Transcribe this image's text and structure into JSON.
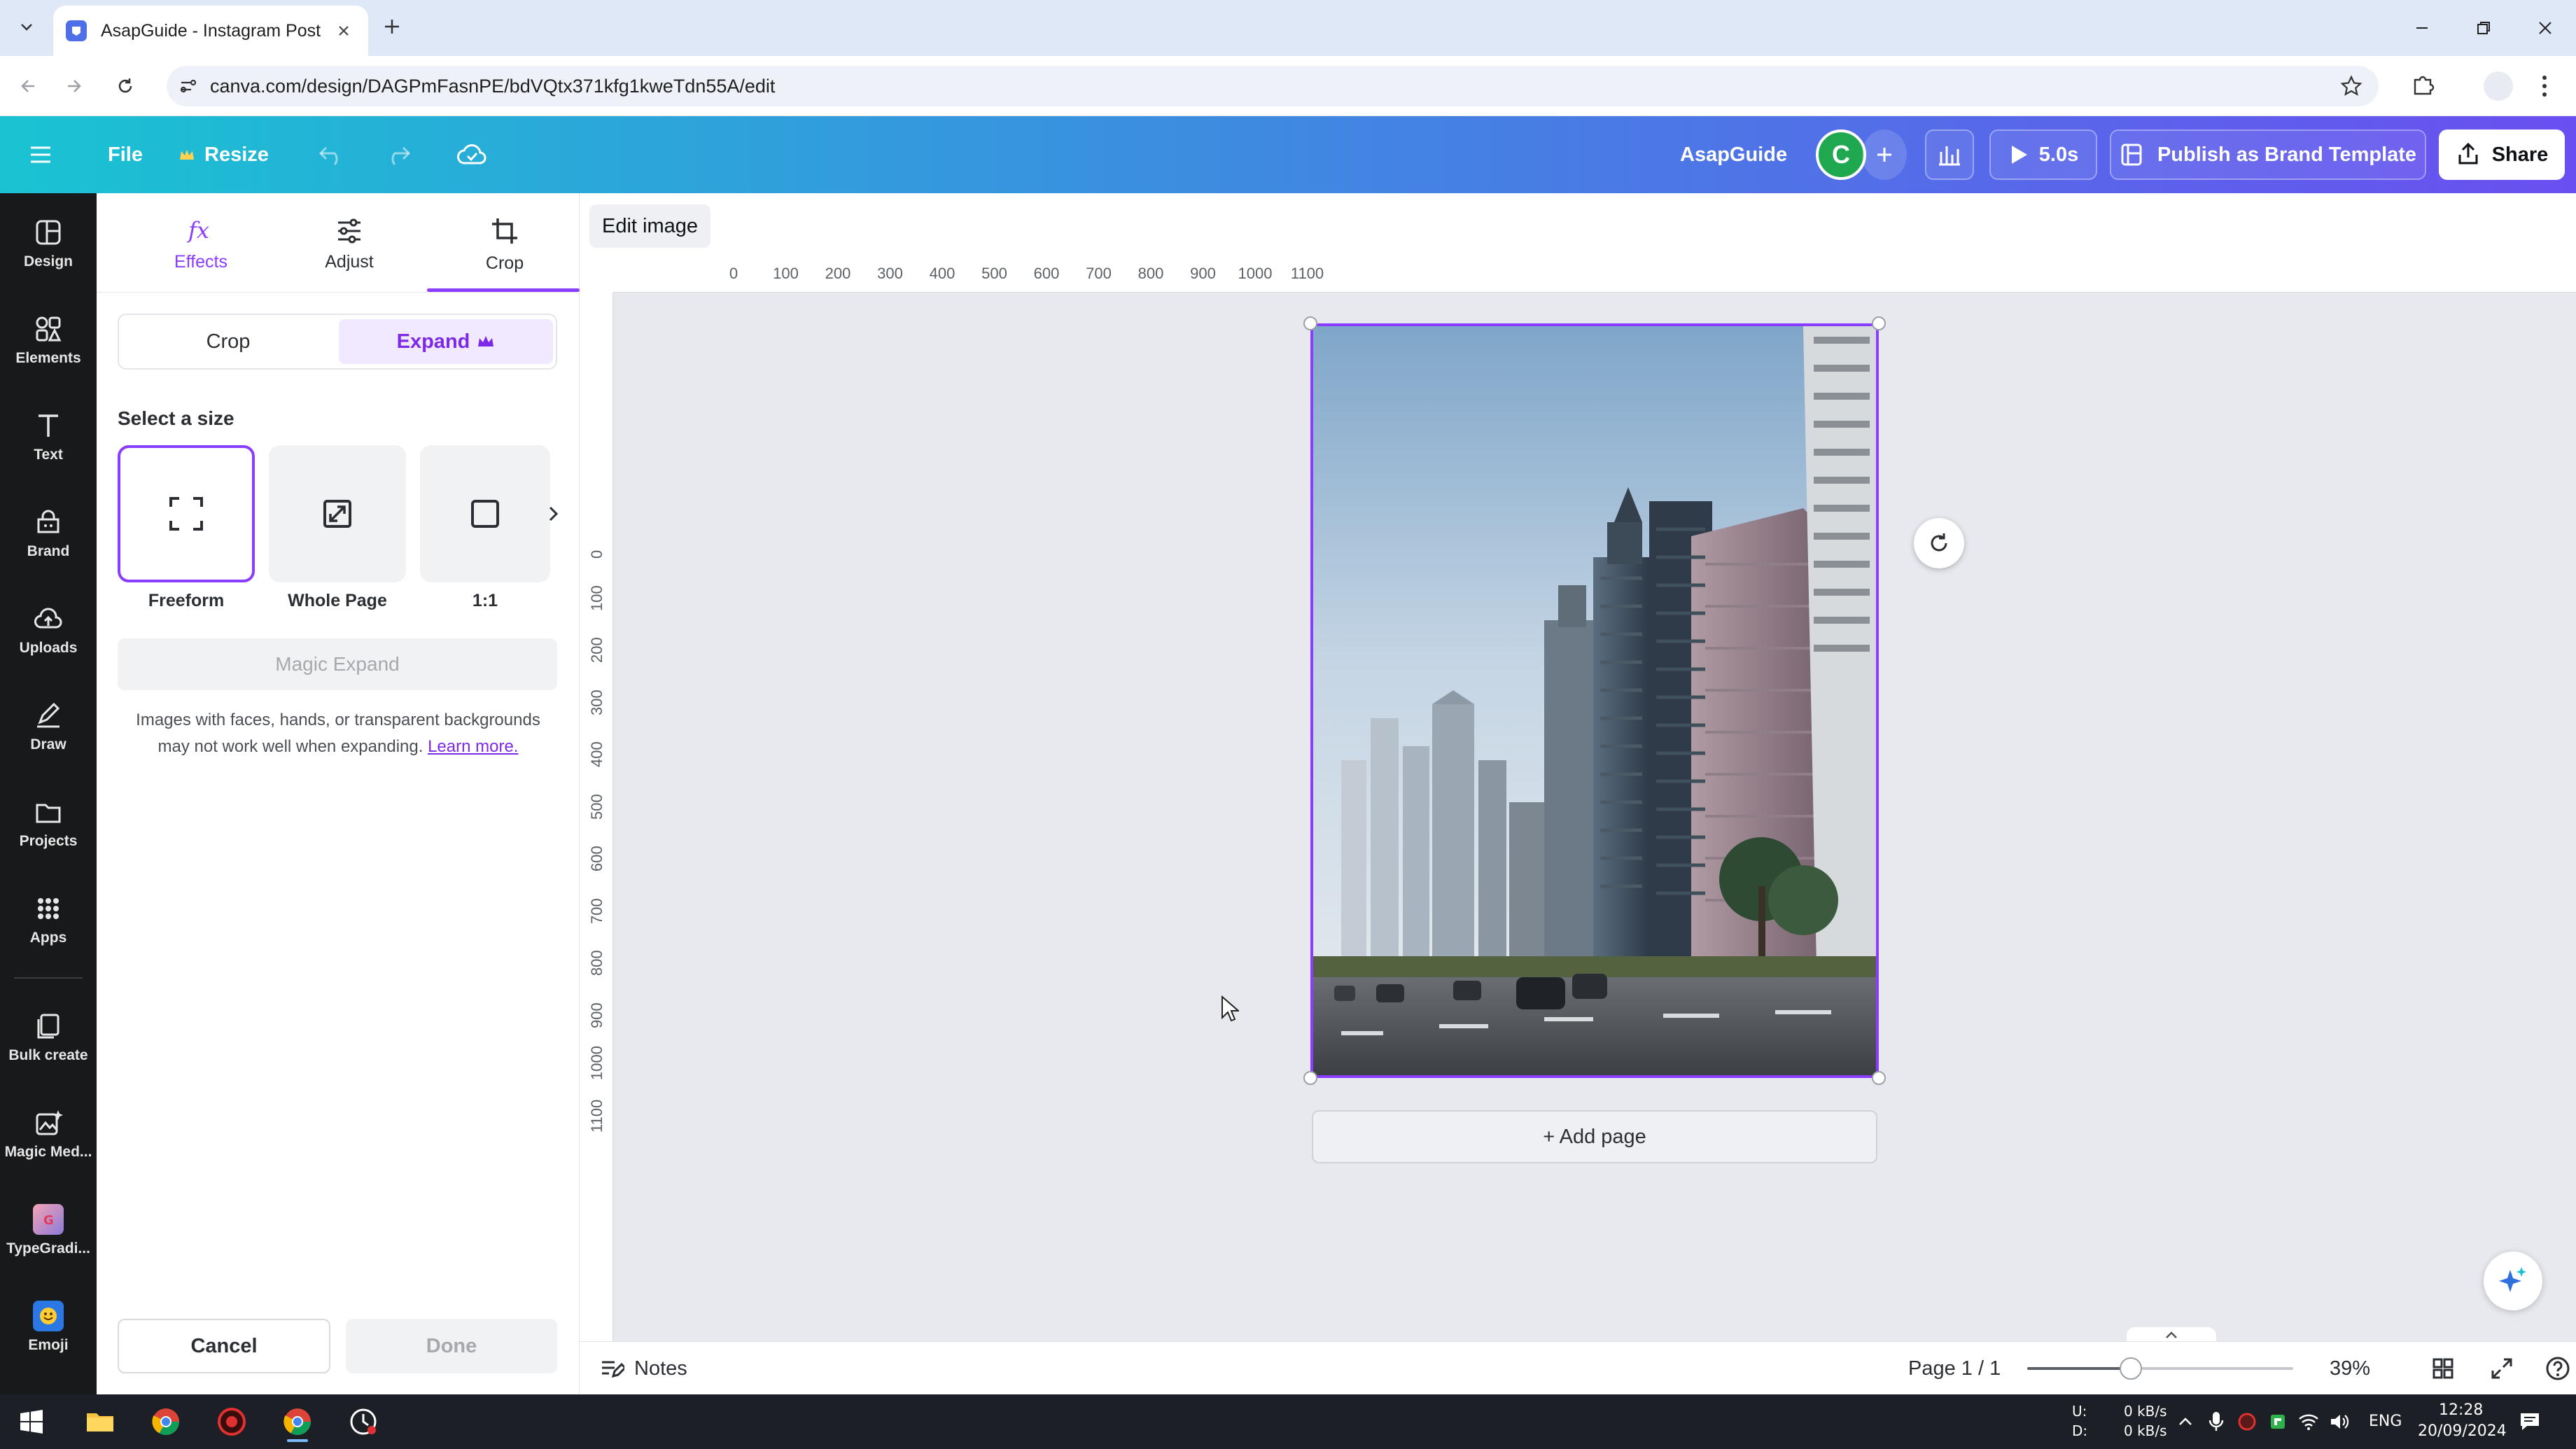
{
  "browser": {
    "tab_title": "AsapGuide - Instagram Post",
    "url": "canva.com/design/DAGPmFasnPE/bdVQtx371kfg1kweTdn55A/edit"
  },
  "header": {
    "file_label": "File",
    "resize_label": "Resize",
    "team_name": "AsapGuide",
    "avatar_initial": "C",
    "present_time": "5.0s",
    "publish_label": "Publish as Brand Template",
    "share_label": "Share",
    "brand_gradient": [
      "#19c3d2",
      "#3b8ee0",
      "#6a4ff0"
    ]
  },
  "left_rail": {
    "items": [
      {
        "label": "Design",
        "icon": "design-icon"
      },
      {
        "label": "Elements",
        "icon": "elements-icon"
      },
      {
        "label": "Text",
        "icon": "text-icon"
      },
      {
        "label": "Brand",
        "icon": "brand-icon"
      },
      {
        "label": "Uploads",
        "icon": "uploads-icon"
      },
      {
        "label": "Draw",
        "icon": "draw-icon"
      },
      {
        "label": "Projects",
        "icon": "projects-icon"
      },
      {
        "label": "Apps",
        "icon": "apps-icon"
      },
      {
        "label": "Bulk create",
        "icon": "bulk-create-icon"
      },
      {
        "label": "Magic Med...",
        "icon": "magic-media-icon"
      },
      {
        "label": "TypeGradi...",
        "icon": "typegradient-app-icon"
      },
      {
        "label": "Emoji",
        "icon": "emoji-app-icon"
      }
    ]
  },
  "panel": {
    "tabs": [
      {
        "label": "Effects",
        "icon": "fx-icon"
      },
      {
        "label": "Adjust",
        "icon": "sliders-icon"
      },
      {
        "label": "Crop",
        "icon": "crop-icon"
      }
    ],
    "active_tab": "Crop",
    "segment": {
      "crop": "Crop",
      "expand": "Expand",
      "expand_badge": "crown-icon"
    },
    "select_size_title": "Select a size",
    "sizes": [
      {
        "label": "Freeform",
        "icon": "freeform-icon",
        "selected": true
      },
      {
        "label": "Whole Page",
        "icon": "whole-page-icon",
        "selected": false
      },
      {
        "label": "1:1",
        "icon": "square-icon",
        "selected": false
      }
    ],
    "magic_expand_label": "Magic Expand",
    "info_text": "Images with faces, hands, or transparent backgrounds may not work well when expanding.",
    "info_link": "Learn more.",
    "cancel_label": "Cancel",
    "done_label": "Done",
    "accent": "#8b3dff"
  },
  "canvas": {
    "edit_image_label": "Edit image",
    "ruler_top": [
      "0",
      "100",
      "200",
      "300",
      "400",
      "500",
      "600",
      "700",
      "800",
      "900",
      "1000",
      "1100"
    ],
    "ruler_left": [
      "0",
      "100",
      "200",
      "300",
      "400",
      "500",
      "600",
      "700",
      "800",
      "900",
      "1000",
      "1100"
    ],
    "add_page_label": "+ Add page",
    "image_subject": "city-skyline-photo"
  },
  "bottom_bar": {
    "notes_label": "Notes",
    "page_indicator": "Page 1 / 1",
    "zoom_value": "39%",
    "zoom_fraction": 0.39
  },
  "taskbar": {
    "net_up_label": "U:",
    "net_down_label": "D:",
    "net_up": "0 kB/s",
    "net_down": "0 kB/s",
    "language": "ENG",
    "time": "12:28",
    "date": "20/09/2024"
  }
}
